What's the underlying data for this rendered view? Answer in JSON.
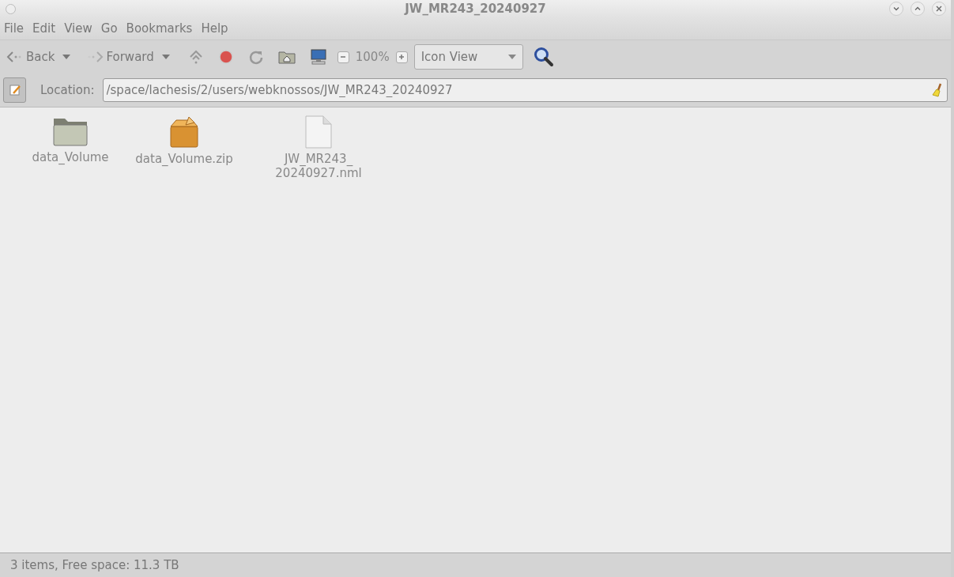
{
  "window": {
    "title": "JW_MR243_20240927"
  },
  "menu": [
    "File",
    "Edit",
    "View",
    "Go",
    "Bookmarks",
    "Help"
  ],
  "toolbar": {
    "back": "Back",
    "forward": "Forward",
    "zoom": "100%",
    "view_mode": "Icon View"
  },
  "location": {
    "label": "Location:",
    "value": "/space/lachesis/2/users/webknossos/JW_MR243_20240927"
  },
  "files": [
    {
      "kind": "folder",
      "label_lines": [
        "data_Volume"
      ]
    },
    {
      "kind": "archive",
      "label_lines": [
        "data_Volume.zip"
      ]
    },
    {
      "kind": "document",
      "label_lines": [
        "JW_MR243_",
        "20240927.nml"
      ]
    }
  ],
  "status_bar": "3 items, Free space: 11.3 TB"
}
